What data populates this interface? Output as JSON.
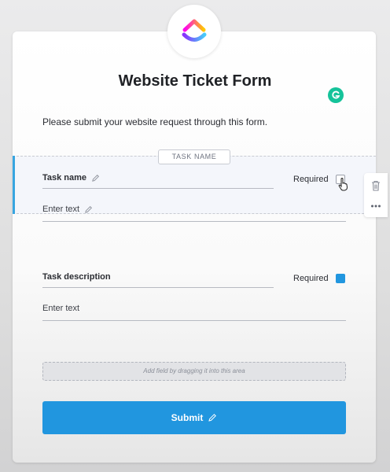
{
  "form": {
    "title": "Website Ticket Form",
    "intro": "Please submit your website request through this form.",
    "logo_icon": "clickup-logo-icon",
    "section_tag": "TASK NAME",
    "fields": [
      {
        "label": "Task name",
        "placeholder": "Enter text",
        "required_label": "Required",
        "required_checked": false
      },
      {
        "label": "Task description",
        "placeholder": "Enter text",
        "required_label": "Required",
        "required_checked": true
      }
    ],
    "dropzone": "Add field by dragging it into this area",
    "submit_label": "Submit"
  },
  "side_tools": [
    "trash-icon",
    "more-options-icon"
  ],
  "colors": {
    "accent": "#2196df",
    "section_accent": "#37a5e0",
    "grammarly": "#15c39a"
  }
}
